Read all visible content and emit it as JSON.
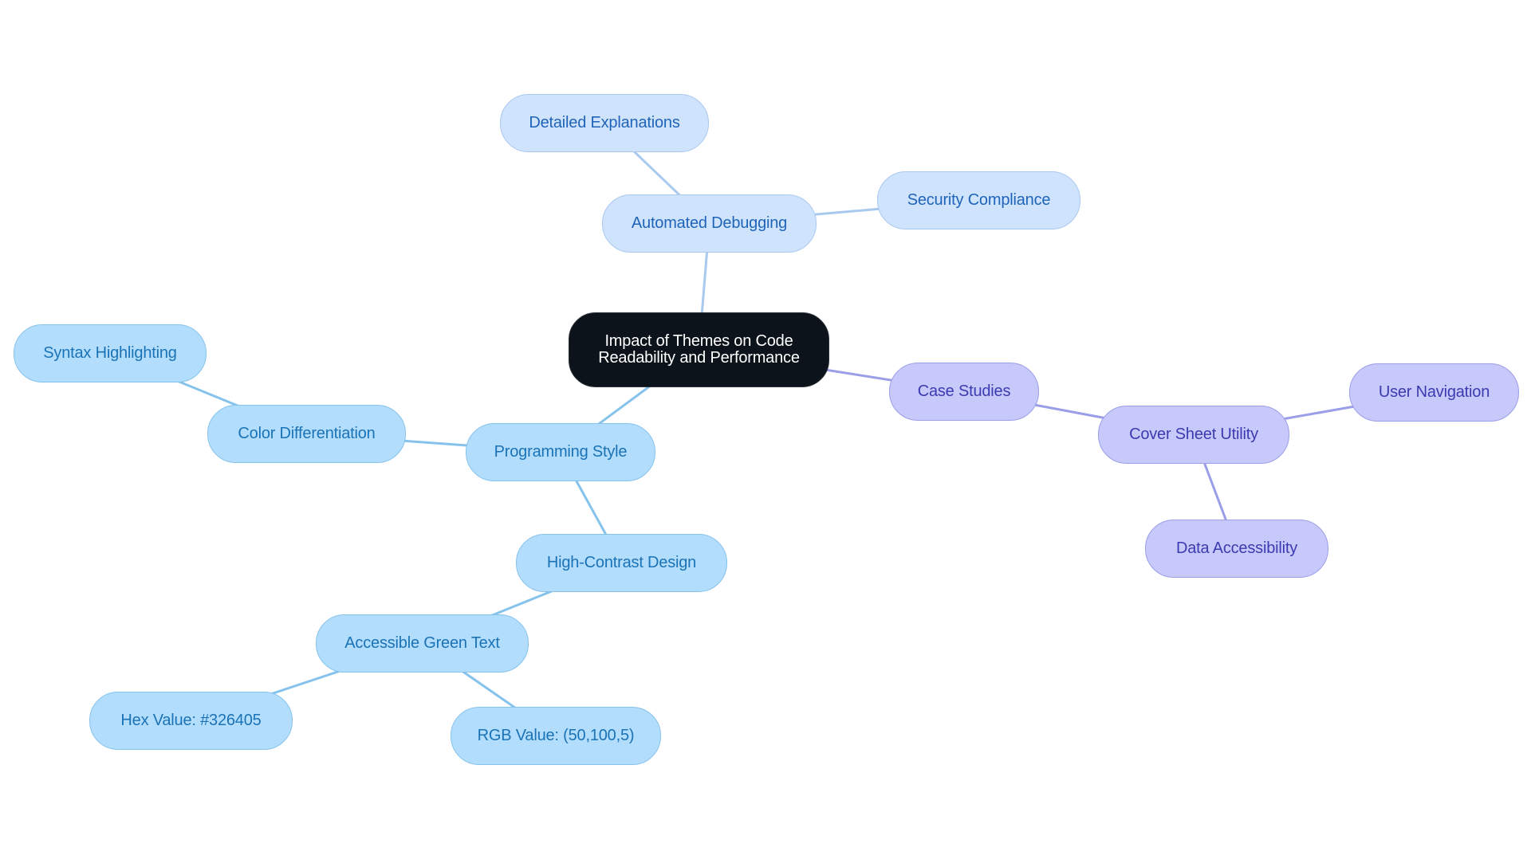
{
  "diagram": {
    "type": "mindmap",
    "colors": {
      "root_fill": "#0c131a",
      "root_text": "#ffffff",
      "sky_fill": "#b3ddfc",
      "sky_stroke": "#86c3ec",
      "sky_text": "#1a73b6",
      "pale_fill": "#cfe3fd",
      "pale_stroke": "#a9c9ef",
      "pale_text": "#1f64b8",
      "violet_fill": "#c8c9fb",
      "violet_stroke": "#9a9ee8",
      "violet_text": "#3a3bb0"
    },
    "root": {
      "id": "root",
      "line1": "Impact of Themes on Code",
      "line2": "Readability and Performance"
    },
    "nodes": [
      {
        "id": "automated-debugging",
        "label": "Automated Debugging",
        "parent": "root",
        "theme": "pale"
      },
      {
        "id": "detailed-explanations",
        "label": "Detailed Explanations",
        "parent": "automated-debugging",
        "theme": "pale"
      },
      {
        "id": "security-compliance",
        "label": "Security Compliance",
        "parent": "automated-debugging",
        "theme": "pale"
      },
      {
        "id": "programming-style",
        "label": "Programming Style",
        "parent": "root",
        "theme": "sky"
      },
      {
        "id": "color-differentiation",
        "label": "Color Differentiation",
        "parent": "programming-style",
        "theme": "sky"
      },
      {
        "id": "syntax-highlighting",
        "label": "Syntax Highlighting",
        "parent": "color-differentiation",
        "theme": "sky"
      },
      {
        "id": "high-contrast-design",
        "label": "High-Contrast Design",
        "parent": "programming-style",
        "theme": "sky"
      },
      {
        "id": "accessible-green-text",
        "label": "Accessible Green Text",
        "parent": "high-contrast-design",
        "theme": "sky"
      },
      {
        "id": "hex-value",
        "label": "Hex Value: #326405",
        "parent": "accessible-green-text",
        "theme": "sky"
      },
      {
        "id": "rgb-value",
        "label": "RGB Value: (50,100,5)",
        "parent": "accessible-green-text",
        "theme": "sky"
      },
      {
        "id": "case-studies",
        "label": "Case Studies",
        "parent": "root",
        "theme": "violet"
      },
      {
        "id": "cover-sheet-utility",
        "label": "Cover Sheet Utility",
        "parent": "case-studies",
        "theme": "violet"
      },
      {
        "id": "user-navigation",
        "label": "User Navigation",
        "parent": "cover-sheet-utility",
        "theme": "violet"
      },
      {
        "id": "data-accessibility",
        "label": "Data Accessibility",
        "parent": "cover-sheet-utility",
        "theme": "violet"
      }
    ]
  }
}
